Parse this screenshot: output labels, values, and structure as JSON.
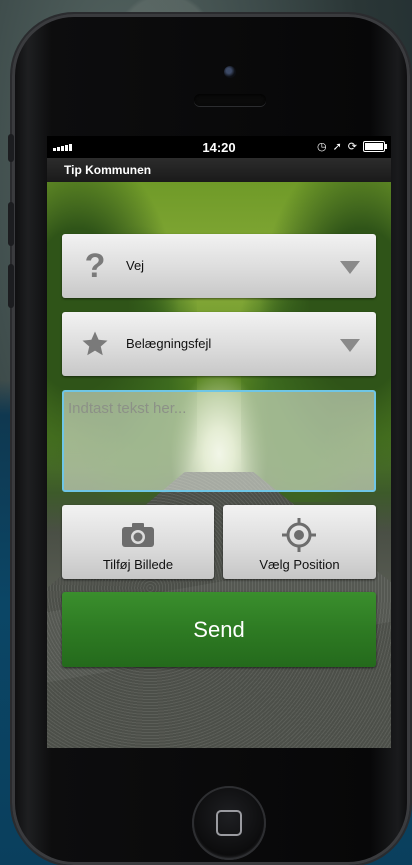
{
  "status_bar": {
    "time": "14:20"
  },
  "app": {
    "title": "Tip Kommunen"
  },
  "form": {
    "category": {
      "icon": "question-icon",
      "selected": "Vej"
    },
    "subcategory": {
      "icon": "star-icon",
      "selected": "Belægningsfejl"
    },
    "message": {
      "placeholder": "Indtast tekst her...",
      "value": ""
    },
    "buttons": {
      "add_photo": "Tilføj Billede",
      "choose_position": "Vælg Position",
      "send": "Send"
    }
  },
  "colors": {
    "send_button": "#2e7b23",
    "textarea_border": "#6fc6e6"
  }
}
